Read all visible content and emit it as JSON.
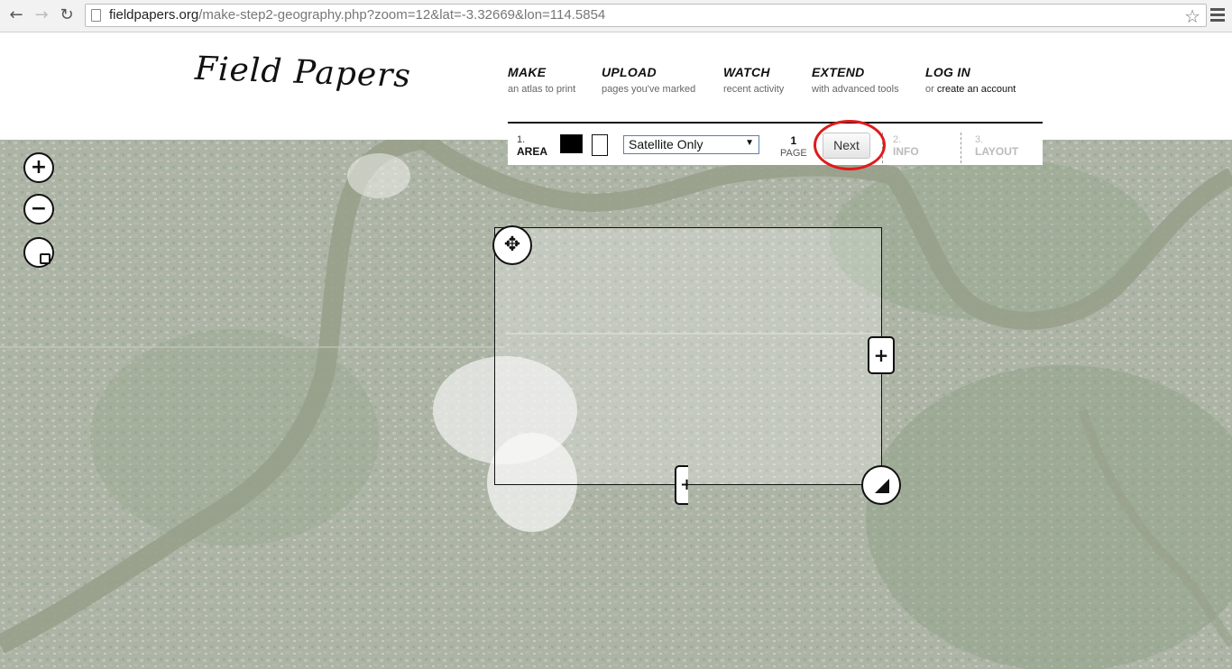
{
  "browser": {
    "back_icon": "arrow-left-icon",
    "forward_icon": "arrow-right-icon",
    "reload_icon": "reload-icon",
    "url_host": "fieldpapers.org",
    "url_path": "/make-step2-geography.php?zoom=12&lat=-3.32669&lon=114.5854"
  },
  "site": {
    "logo": "Field Papers",
    "menu": [
      {
        "title": "MAKE",
        "sub": "an atlas to print"
      },
      {
        "title": "UPLOAD",
        "sub": "pages you've marked"
      },
      {
        "title": "WATCH",
        "sub": "recent activity"
      },
      {
        "title": "EXTEND",
        "sub": "with advanced tools"
      },
      {
        "title": "LOG IN",
        "sub_prefix": "or ",
        "sub_link": "create an account"
      }
    ]
  },
  "toolbar": {
    "step1_num": "1.",
    "step1_label": "AREA",
    "provider_selected": "Satellite Only",
    "page_count": "1",
    "page_label": "PAGE",
    "next_label": "Next",
    "step2_num": "2.",
    "step2_label": "INFO",
    "step3_num": "3.",
    "step3_label": "LAYOUT"
  },
  "map_controls": {
    "zoom_in": "+",
    "zoom_out": "−"
  },
  "colors": {
    "highlight": "#e01a1a",
    "map_base": "#7f8d78",
    "river": "#6f7a5c"
  }
}
